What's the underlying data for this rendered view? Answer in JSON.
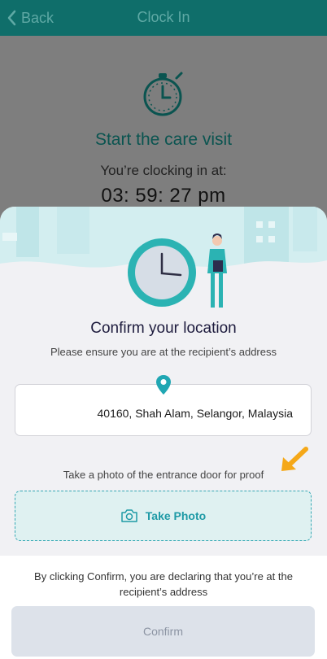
{
  "header": {
    "back_label": "Back",
    "title": "Clock In"
  },
  "clockin": {
    "title": "Start the care visit",
    "label": "You’re clocking in at:",
    "time": "03: 59: 27 pm"
  },
  "sheet": {
    "title": "Confirm your location",
    "subtitle": "Please ensure you are at the recipient’s address",
    "address": "40160, Shah Alam, Selangor, Malaysia",
    "photo_hint": "Take a photo of the entrance door for proof",
    "take_photo_label": "Take Photo"
  },
  "footer": {
    "declaration": "By clicking Confirm, you are declaring that you’re at the recipient’s address",
    "confirm_label": "Confirm"
  },
  "colors": {
    "header": "#0f6e6a",
    "teal_accent": "#1e9aa6",
    "arrow": "#f5a818",
    "button_disabled": "#dde2ea"
  }
}
